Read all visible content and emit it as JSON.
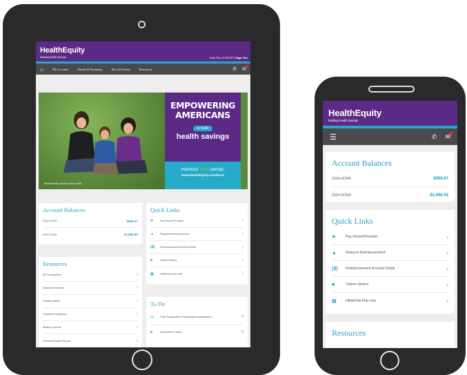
{
  "tablet": {
    "brand": "HealthEquity",
    "tagline": "Building Health Savings",
    "user_text": "John Doe (1234567)",
    "sign_out": "Sign Out",
    "nav": [
      "My Account",
      "Claims & Payments",
      "Docs & Forms",
      "Resources"
    ],
    "hero": {
      "line1": "EMPOWERING",
      "line2": "AMERICANS",
      "pill": "to build",
      "line3": "health savings",
      "maximize": "maximize",
      "green_word": "your",
      "savings": "savings:",
      "url": "www.HealthEquity.com/learn",
      "caption": "Beutel family, member since 2008"
    },
    "balances": {
      "title": "Account Balances",
      "rows": [
        {
          "label": "2014 HCRA",
          "value": "$999.97"
        },
        {
          "label": "2014 DCRA",
          "value": "$2,666.56"
        }
      ]
    },
    "quick_links": {
      "title": "Quick Links",
      "items": [
        "Pay Doctor/Provider",
        "Request Reimbursement",
        "Reimbursement Account Detail",
        "Claims History",
        "HRA/FSA Plan Info"
      ]
    },
    "resources": {
      "title": "Resources",
      "items": [
        "$4 Prescriptions",
        "Disease Research",
        "Healthy Habits",
        "Hospital Comparison",
        "Medical Journal",
        "Personal Health Record"
      ]
    },
    "todo": {
      "title": "To Do",
      "items": [
        {
          "label": "Card Transactions Requiring Documentation",
          "count": "0"
        },
        {
          "label": "Unresolved Claims",
          "count": "0"
        }
      ]
    }
  },
  "phone": {
    "brand": "HealthEquity",
    "tagline": "Building Health Savings",
    "balances": {
      "title": "Account Balances",
      "rows": [
        {
          "label": "2014 HCRA",
          "value": "$999.97"
        },
        {
          "label": "2014 DCRA",
          "value": "$2,666.56"
        }
      ]
    },
    "quick_links": {
      "title": "Quick Links",
      "items": [
        "Pay Doctor/Provider",
        "Request Reimbursement",
        "Reimbursement Account Detail",
        "Claims History",
        "HRA/FSA Plan Info"
      ]
    },
    "resources_title": "Resources"
  },
  "colors": {
    "purple": "#5b2a86",
    "teal": "#27a9c9",
    "nav_gray": "#4a4a4c",
    "link_blue": "#27a0c6",
    "alert_red": "#d9342b"
  }
}
